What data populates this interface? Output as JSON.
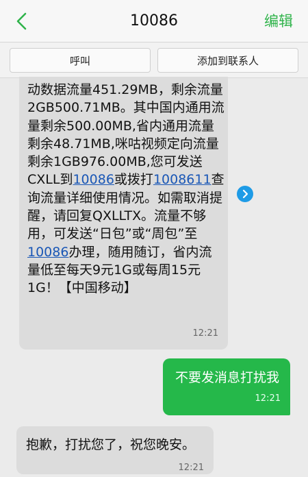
{
  "header": {
    "title": "10086",
    "edit_label": "编辑"
  },
  "actions": {
    "call_label": "呼叫",
    "add_contact_label": "添加到联系人"
  },
  "messages": [
    {
      "direction": "incoming",
      "parts": [
        {
          "type": "text",
          "value": "动数据流量451.29MB，剩余流量2GB500.71MB。其中国内通用流量剩余500.00MB,省内通用流量剩余48.71MB,咪咕视频定向流量剩余1GB976.00MB,您可发送CXLL到"
        },
        {
          "type": "link",
          "value": "10086"
        },
        {
          "type": "text",
          "value": "或拨打"
        },
        {
          "type": "link",
          "value": "1008611"
        },
        {
          "type": "text",
          "value": "查询流量详细使用情况。如需取消提醒，请回复QXLLTX。流量不够用，可发送“日包”或“周包”至"
        },
        {
          "type": "link",
          "value": "10086"
        },
        {
          "type": "text",
          "value": "办理，随用随订，省内流量低至每天9元1G或每周15元1G！【中国移动】"
        }
      ],
      "time": "12:21"
    },
    {
      "direction": "outgoing",
      "text": "不要发消息打扰我",
      "time": "12:21"
    },
    {
      "direction": "incoming",
      "text": "抱歉，打扰您了，祝您晚安。",
      "time": "12:21"
    }
  ],
  "icons": {
    "back": "chevron-left-icon",
    "expand": "chevron-right-circle-icon"
  },
  "colors": {
    "accent_green": "#2fb34a",
    "outgoing_bubble": "#25b84a",
    "incoming_bubble": "#dcdcdc",
    "link": "#1a57b6",
    "arrow_blue": "#1e9be6"
  }
}
